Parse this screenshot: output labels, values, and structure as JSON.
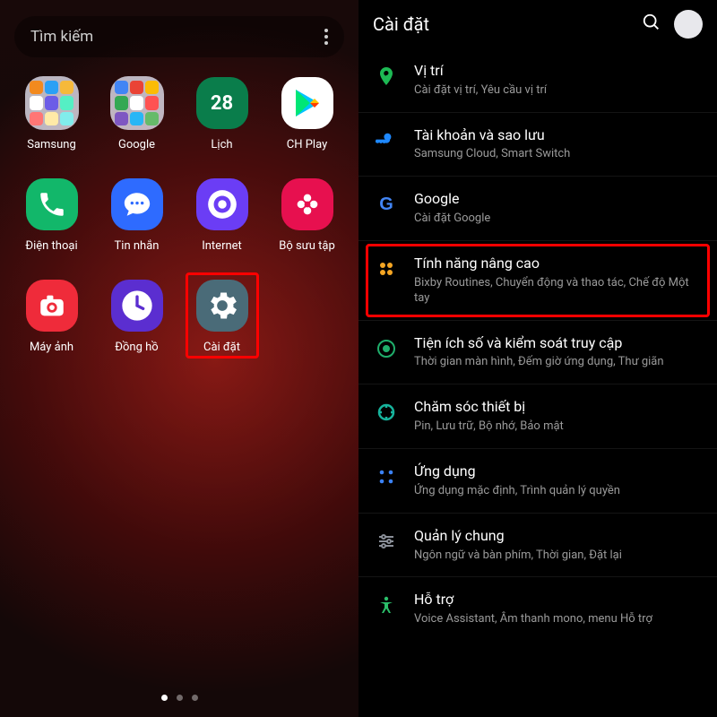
{
  "left": {
    "search_placeholder": "Tìm kiếm",
    "apps": [
      {
        "label": "Samsung",
        "type": "folder",
        "minis": [
          "#f28a1e",
          "#2aa0f5",
          "#f6b93b",
          "#ffffff",
          "#6c5ce7",
          "#55efc4",
          "#ff7675",
          "#ffeaa7",
          "#81ecec"
        ]
      },
      {
        "label": "Google",
        "type": "folder",
        "minis": [
          "#4285F4",
          "#EA4335",
          "#FBBC05",
          "#34A853",
          "#ffffff",
          "#ff5252",
          "#7e57c2",
          "#29b6f6",
          "#66bb6a"
        ]
      },
      {
        "label": "Lịch",
        "type": "icon",
        "bg": "#0a7d4b",
        "glyph": "28",
        "glyph_size": "22px",
        "glyph_weight": "700",
        "glyph_color": "#fff"
      },
      {
        "label": "CH Play",
        "type": "play"
      },
      {
        "label": "Điện thoại",
        "type": "icon",
        "bg": "#12b76a",
        "svg": "phone"
      },
      {
        "label": "Tin nhắn",
        "type": "icon",
        "bg": "#2e6bff",
        "svg": "msg"
      },
      {
        "label": "Internet",
        "type": "icon",
        "bg": "#6b3df5",
        "svg": "globe"
      },
      {
        "label": "Bộ sưu tập",
        "type": "icon",
        "bg": "#e7104f",
        "svg": "flower"
      },
      {
        "label": "Máy ảnh",
        "type": "icon",
        "bg": "#ef2b3a",
        "svg": "camera"
      },
      {
        "label": "Đồng hồ",
        "type": "icon",
        "bg": "#5b2ed0",
        "svg": "clock"
      },
      {
        "label": "Cài đặt",
        "type": "icon",
        "bg": "#4a6b78",
        "svg": "gear",
        "highlight": true
      }
    ],
    "page_indicator": {
      "count": 3,
      "active": 0
    }
  },
  "right": {
    "title": "Cài đặt",
    "items": [
      {
        "icon": "location",
        "color": "#1db954",
        "title": "Vị trí",
        "sub": "Cài đặt vị trí, Yêu cầu vị trí"
      },
      {
        "icon": "key",
        "color": "#1e88ff",
        "title": "Tài khoản và sao lưu",
        "sub": "Samsung Cloud, Smart Switch"
      },
      {
        "icon": "google",
        "color": "#4285F4",
        "title": "Google",
        "sub": "Cài đặt Google"
      },
      {
        "icon": "advanced",
        "color": "#f5a623",
        "title": "Tính năng nâng cao",
        "sub": "Bixby Routines, Chuyển động và thao tác, Chế độ Một tay",
        "highlight": true
      },
      {
        "icon": "wellbeing",
        "color": "#1fae6b",
        "title": "Tiện ích số và kiểm soát truy cập",
        "sub": "Thời gian màn hình, Đếm giờ ứng dụng, Thư giãn"
      },
      {
        "icon": "devicecare",
        "color": "#17b39c",
        "title": "Chăm sóc thiết bị",
        "sub": "Pin, Lưu trữ, Bộ nhớ, Bảo mật"
      },
      {
        "icon": "apps",
        "color": "#3b82f6",
        "title": "Ứng dụng",
        "sub": "Ứng dụng mặc định, Trình quản lý quyền"
      },
      {
        "icon": "general",
        "color": "#8a8f98",
        "title": "Quản lý chung",
        "sub": "Ngôn ngữ và bàn phím, Thời gian, Đặt lại"
      },
      {
        "icon": "accessibility",
        "color": "#2bbf6a",
        "title": "Hỗ trợ",
        "sub": "Voice Assistant, Âm thanh mono, menu Hỗ trợ"
      }
    ]
  }
}
